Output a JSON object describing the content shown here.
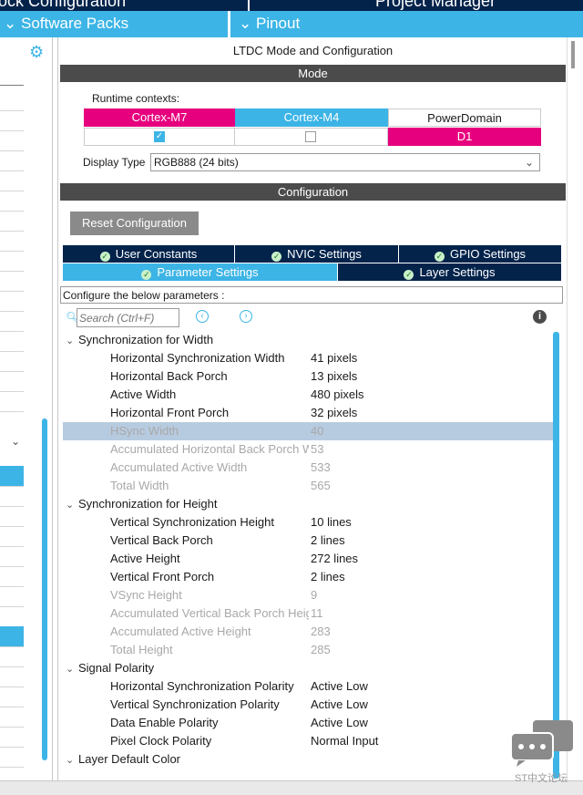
{
  "top": {
    "left_title": "ock Configuration",
    "right_title": "Project Manager"
  },
  "sec": {
    "software_packs": "Software Packs",
    "pinout": "Pinout"
  },
  "window": {
    "title": "LTDC Mode and Configuration",
    "mode_bar": "Mode",
    "runtime_label": "Runtime contexts:",
    "contexts": [
      {
        "name": "Cortex-M7",
        "color": "#e6007e",
        "checked": true
      },
      {
        "name": "Cortex-M4",
        "color": "#3cb4e6",
        "checked": false
      },
      {
        "name": "PowerDomain",
        "value": "D1",
        "value_color": "#e6007e"
      }
    ],
    "display_type_label": "Display Type",
    "display_type_value": "RGB888 (24 bits)",
    "config_bar": "Configuration",
    "reset_button": "Reset Configuration",
    "tabs_row1": [
      "User Constants",
      "NVIC Settings",
      "GPIO Settings"
    ],
    "tabs_row2": [
      "Parameter Settings",
      "Layer Settings"
    ],
    "configure_hint": "Configure the below parameters :",
    "search_placeholder": "Search (Ctrl+F)"
  },
  "groups": {
    "width": "Synchronization for Width",
    "height": "Synchronization for Height",
    "polarity": "Signal Polarity",
    "color": "Layer Default Color"
  },
  "params": [
    {
      "name": "Horizontal Synchronization Width",
      "value": "41 pixels"
    },
    {
      "name": "Horizontal Back Porch",
      "value": "13 pixels"
    },
    {
      "name": "Active Width",
      "value": "480 pixels"
    },
    {
      "name": "Horizontal Front Porch",
      "value": "32 pixels"
    },
    {
      "name": "HSync Width",
      "value": "40"
    },
    {
      "name": "Accumulated Horizontal Back Porch Wi",
      "value": "53"
    },
    {
      "name": "Accumulated Active Width",
      "value": "533"
    },
    {
      "name": "Total Width",
      "value": "565"
    },
    {
      "name": "Vertical Synchronization Height",
      "value": "10 lines"
    },
    {
      "name": "Vertical Back Porch",
      "value": "2 lines"
    },
    {
      "name": "Active Height",
      "value": "272 lines"
    },
    {
      "name": "Vertical Front Porch",
      "value": "2 lines"
    },
    {
      "name": "VSync Height",
      "value": "9"
    },
    {
      "name": "Accumulated Vertical Back Porch Heig.",
      "value": "11"
    },
    {
      "name": "Accumulated Active Height",
      "value": "283"
    },
    {
      "name": "Total Height",
      "value": "285"
    },
    {
      "name": "Horizontal Synchronization Polarity",
      "value": "Active Low"
    },
    {
      "name": "Vertical Synchronization Polarity",
      "value": "Active Low"
    },
    {
      "name": "Data Enable Polarity",
      "value": "Active Low"
    },
    {
      "name": "Pixel Clock Polarity",
      "value": "Normal Input"
    }
  ],
  "watermark": "ST中文论坛",
  "colors": {
    "accent": "#3cb4e6",
    "navy": "#03234b",
    "magenta": "#e6007e",
    "gray_bar": "#4b4b4b",
    "disabled_text": "#a8a8a8",
    "selected_row": "#b7cbe0"
  }
}
